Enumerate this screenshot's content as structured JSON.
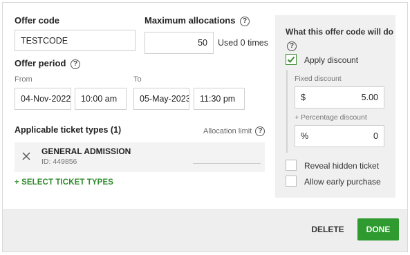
{
  "offer_code": {
    "label": "Offer code",
    "value": "TESTCODE"
  },
  "max_allocations": {
    "label": "Maximum allocations",
    "value": "50",
    "used_text": "Used 0 times"
  },
  "offer_period": {
    "label": "Offer period",
    "from_label": "From",
    "to_label": "To",
    "from_date": "04-Nov-2022",
    "from_time": "10:00 am",
    "to_date": "05-May-2023",
    "to_time": "11:30 pm"
  },
  "tickets": {
    "header": "Applicable ticket types (1)",
    "allocation_limit_label": "Allocation limit",
    "rows": [
      {
        "name": "GENERAL ADMISSION",
        "id_text": "ID: 449856"
      }
    ],
    "select_link": "+ SELECT TICKET TYPES"
  },
  "right_panel": {
    "title": "What this offer code will do",
    "apply_discount": {
      "label": "Apply discount",
      "checked": true
    },
    "fixed_discount": {
      "label": "Fixed discount",
      "prefix": "$",
      "value": "5.00"
    },
    "percentage_discount": {
      "label": "+ Percentage discount",
      "prefix": "%",
      "value": "0"
    },
    "reveal_hidden": {
      "label": "Reveal hidden ticket",
      "checked": false
    },
    "early_purchase": {
      "label": "Allow early purchase",
      "checked": false
    }
  },
  "footer": {
    "delete_label": "DELETE",
    "done_label": "DONE"
  },
  "colors": {
    "accent_green": "#2e9a2f",
    "panel_bg": "#f0f0f0",
    "footer_bg": "#eeeeee"
  },
  "icons": {
    "help": "question-circle-icon",
    "remove": "close-icon",
    "check": "checkmark-icon"
  }
}
